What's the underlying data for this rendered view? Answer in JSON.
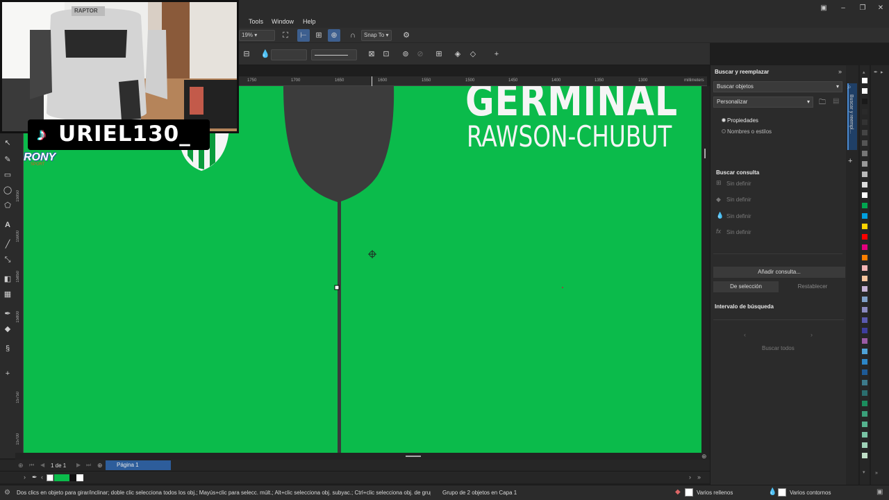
{
  "menu": {
    "tools": "Tools",
    "window": "Window",
    "help": "Help"
  },
  "toolbar": {
    "zoom": "19%",
    "snap_to": "Snap To"
  },
  "ruler": {
    "units": "millimeters",
    "ticks": [
      "1750",
      "1700",
      "1650",
      "1600",
      "1550",
      "1500",
      "1450",
      "1400",
      "1350",
      "1300"
    ],
    "vticks": [
      "15950",
      "15900",
      "15850",
      "15800",
      "15750",
      "15700"
    ]
  },
  "canvas": {
    "title_line1": "GERMINAL",
    "title_line2": "RAWSON-CHUBUT",
    "logo_text": "RONY",
    "logo_sub": "SPORT"
  },
  "page_nav": {
    "counter": "1 de 1",
    "page_tab": "Página 1"
  },
  "status": {
    "hint": "Dos clics en objeto para girar/inclinar; doble clic selecciona todos los obj.; Mayús+clic para selecc. múlt.; Alt+clic selecciona obj. subyac.; Ctrl+clic selecciona obj. de grupo",
    "selection": "Grupo de 2 objetos en Capa 1",
    "fill": "Varios rellenos",
    "outline": "Varios contornos"
  },
  "docker": {
    "title": "Buscar y reemplazar",
    "mode": "Buscar objetos",
    "preset": "Personalizar",
    "radio_properties": "Propiedades",
    "radio_names": "Nombres o estilos",
    "query_header": "Buscar consulta",
    "query_items": [
      "Sin definir",
      "Sin definir",
      "Sin definir",
      "Sin definir"
    ],
    "add_query": "Añadir consulta...",
    "from_selection": "De selección",
    "reset": "Restablecer",
    "range_header": "Intervalo de búsqueda",
    "find_all": "Buscar todos",
    "vertical_tab": "Buscar y reempl..."
  },
  "overlay": {
    "tiktok_handle": "URIEL130_",
    "chair_brand": "RAPTOR"
  },
  "colors": {
    "canvas_green": "#0bbb4b",
    "shirt_dark": "#3c3c3c",
    "accent_blue": "#2d5d9b"
  },
  "palette": [
    "#ffffff",
    "#ffffff",
    "#1a1a1a",
    "#2a2a2a",
    "#333333",
    "#444444",
    "#555555",
    "#777777",
    "#999999",
    "#bbbbbb",
    "#dddddd",
    "#ffffff",
    "#00a650",
    "#00a0e0",
    "#ffd400",
    "#ff0000",
    "#e6007e",
    "#ff7f00",
    "#f7b6b6",
    "#f8c59d",
    "#c7b3d6",
    "#7fa0c8",
    "#8a8ac0",
    "#5a5ab0",
    "#3e3e9e",
    "#9b5ba5",
    "#4fa3d8",
    "#2c86c7",
    "#1e5a96",
    "#3d7a8a",
    "#2b6e6e",
    "#1b8e5e",
    "#3aa07a",
    "#55b38f",
    "#79c4a5",
    "#9fd2b8",
    "#c0dec7"
  ]
}
